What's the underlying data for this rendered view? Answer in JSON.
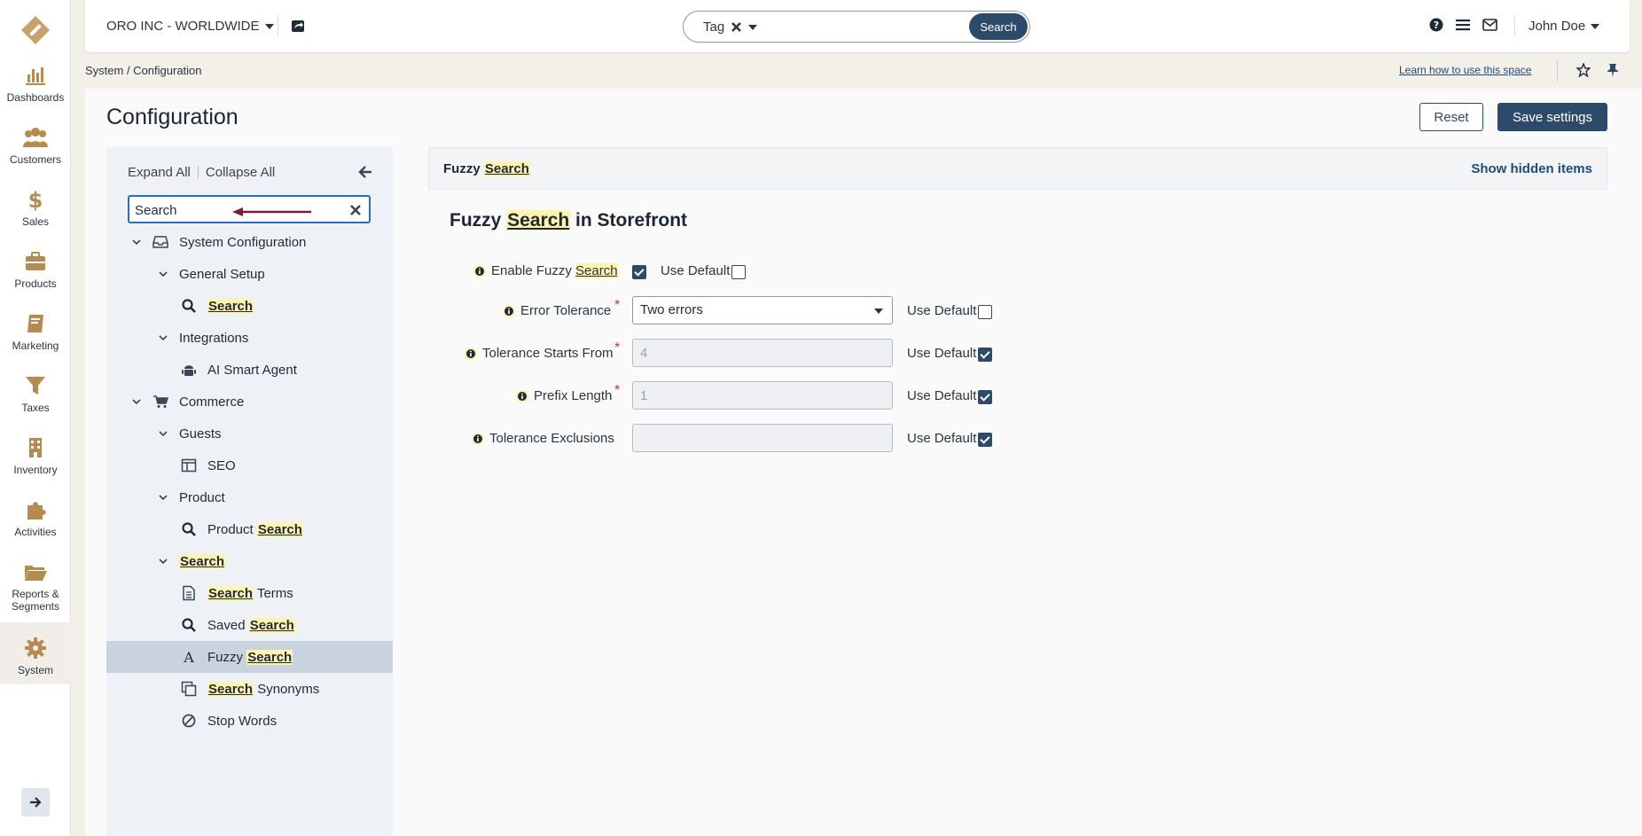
{
  "org": {
    "name": "ORO INC - WORLDWIDE"
  },
  "rail": {
    "items": [
      {
        "label": "Dashboards"
      },
      {
        "label": "Customers"
      },
      {
        "label": "Sales"
      },
      {
        "label": "Products"
      },
      {
        "label": "Marketing"
      },
      {
        "label": "Taxes"
      },
      {
        "label": "Inventory"
      },
      {
        "label": "Activities"
      },
      {
        "label": "Reports &",
        "label2": "Segments"
      },
      {
        "label": "System"
      }
    ]
  },
  "search": {
    "tag": "Tag",
    "button": "Search"
  },
  "user": {
    "name": "John Doe"
  },
  "breadcrumb": "System / Configuration",
  "learn_link": "Learn how to use this space",
  "page": {
    "title": "Configuration",
    "reset": "Reset",
    "save": "Save settings"
  },
  "tree": {
    "expand_all": "Expand All",
    "collapse_all": "Collapse All",
    "search_value": "Search",
    "nodes": [
      {
        "pre": "System Configuration",
        "hl": "",
        "post": ""
      },
      {
        "pre": "General Setup",
        "hl": "",
        "post": ""
      },
      {
        "pre": "",
        "hl": "Search",
        "post": ""
      },
      {
        "pre": "Integrations",
        "hl": "",
        "post": ""
      },
      {
        "pre": "AI Smart Agent",
        "hl": "",
        "post": ""
      },
      {
        "pre": "Commerce",
        "hl": "",
        "post": ""
      },
      {
        "pre": "Guests",
        "hl": "",
        "post": ""
      },
      {
        "pre": "SEO",
        "hl": "",
        "post": ""
      },
      {
        "pre": "Product",
        "hl": "",
        "post": ""
      },
      {
        "pre": "Product ",
        "hl": "Search",
        "post": ""
      },
      {
        "pre": "",
        "hl": "Search",
        "post": ""
      },
      {
        "pre": "",
        "hl": "Search",
        "post": " Terms"
      },
      {
        "pre": "Saved ",
        "hl": "Search",
        "post": ""
      },
      {
        "pre": "Fuzzy ",
        "hl": "Search",
        "post": ""
      },
      {
        "pre": "",
        "hl": "Search",
        "post": " Synonyms"
      },
      {
        "pre": "Stop Words",
        "hl": "",
        "post": ""
      }
    ]
  },
  "section": {
    "title_pre": "Fuzzy ",
    "title_hl": "Search",
    "show_hidden": "Show hidden items"
  },
  "group": {
    "pre": "Fuzzy ",
    "hl": "Search",
    "post": " in Storefront"
  },
  "fields": {
    "enable": {
      "label_pre": "Enable Fuzzy ",
      "label_hl": "Search",
      "use_default": "Use Default"
    },
    "error_tolerance": {
      "label": "Error Tolerance",
      "value": "Two errors",
      "use_default": "Use Default"
    },
    "tolerance_starts": {
      "label": "Tolerance Starts From",
      "value": "4",
      "use_default": "Use Default"
    },
    "prefix_length": {
      "label": "Prefix Length",
      "value": "1",
      "use_default": "Use Default"
    },
    "tolerance_exclusions": {
      "label": "Tolerance Exclusions",
      "value": "",
      "use_default": "Use Default"
    }
  }
}
